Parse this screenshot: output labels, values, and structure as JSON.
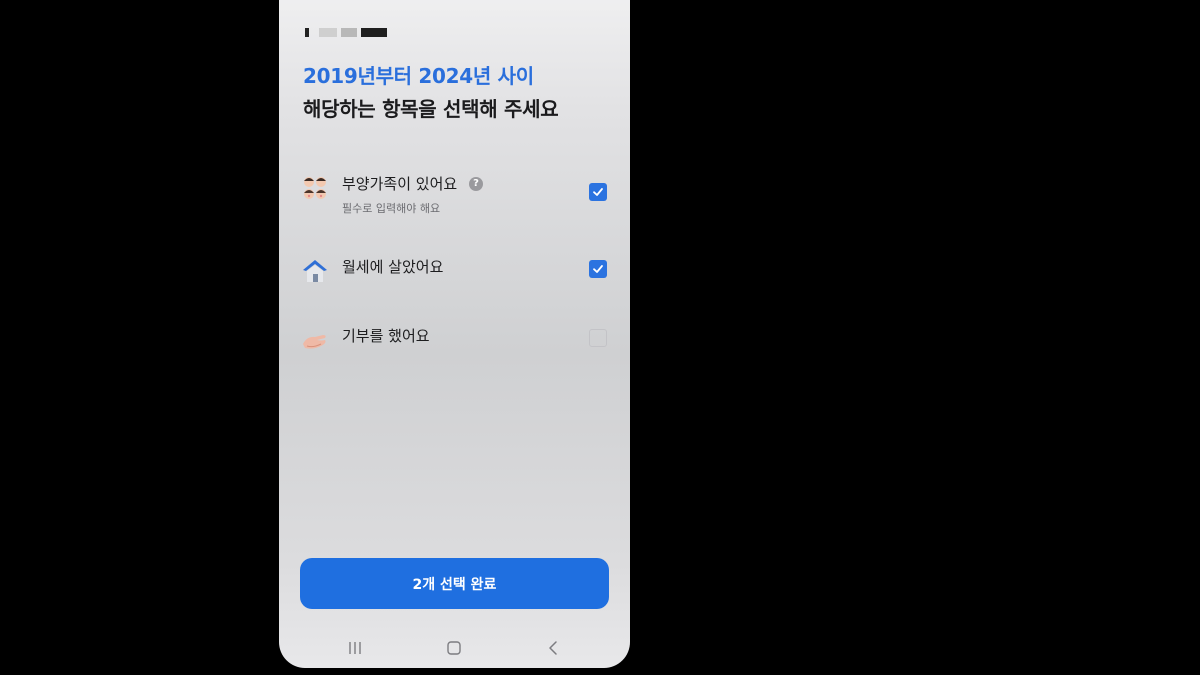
{
  "header": {
    "subtitle": "2019년부터 2024년 사이",
    "title": "해당하는 항목을 선택해 주세요"
  },
  "items": [
    {
      "label": "부양가족이 있어요",
      "help": "?",
      "description": "필수로 입력해야 해요",
      "checked": true,
      "icon": "family-icon"
    },
    {
      "label": "월세에 살았어요",
      "checked": true,
      "icon": "house-icon"
    },
    {
      "label": "기부를 했어요",
      "checked": false,
      "icon": "donation-hand-icon"
    }
  ],
  "cta": {
    "label": "2개 선택 완료"
  },
  "colors": {
    "accent": "#1f6fe0",
    "subtitle": "#2a6fdc",
    "checkbox_on": "#2b73e0",
    "checkbox_off_border": "#c3c3c7",
    "background": "#000000"
  },
  "nav": {
    "icons": [
      "recent-apps-icon",
      "home-icon",
      "back-icon"
    ]
  }
}
